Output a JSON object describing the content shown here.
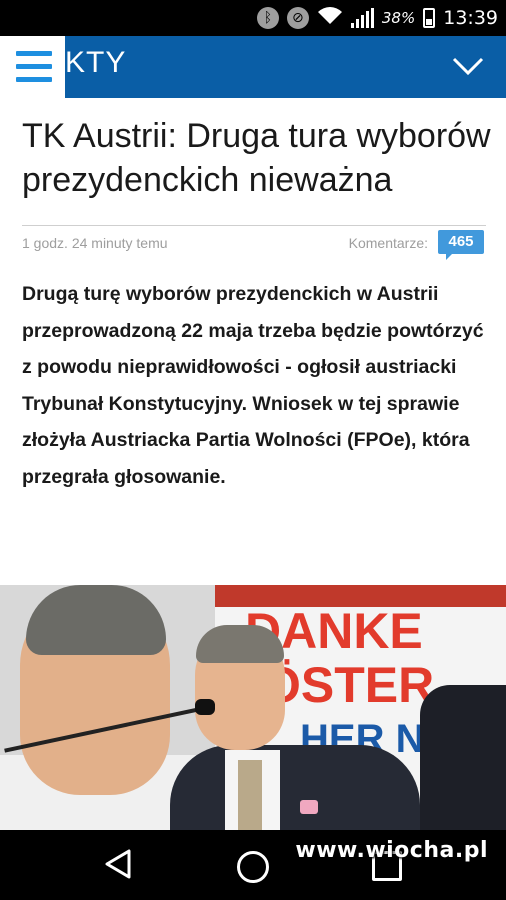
{
  "status_bar": {
    "icons": [
      "bluetooth-icon",
      "do-not-disturb-icon",
      "wifi-icon",
      "signal-icon",
      "battery-icon"
    ],
    "battery_percent": "38%",
    "time": "13:39"
  },
  "header": {
    "section_label": "KTY",
    "menu_icon": "hamburger-menu-icon",
    "expand_icon": "chevron-down-icon",
    "bg_color": "#0a5ea6",
    "accent_color": "#1e8fe0"
  },
  "article": {
    "title": "TK Austrii: Druga tura wyborów prezydenckich nieważna",
    "timestamp": "1 godz. 24 minuty temu",
    "comments_label": "Komentarze:",
    "comments_count": "465",
    "lead": "Drugą turę wyborów prezydenckich w Austrii przeprowadzoną 22 maja trzeba będzie powtórzyć z powodu nieprawidłowości - ogłosił austriacki Trybunał Konstytucyjny. Wniosek w tej sprawie złożyła Austriacka Partia Wolności (FPOe), która przegrała głosowanie.",
    "photo": {
      "banner_line1": "DANKE",
      "banner_line2": "ÖSTER",
      "banner_line3": "HER NO"
    }
  },
  "system_nav": {
    "buttons": [
      "back-icon",
      "home-icon",
      "recent-apps-icon"
    ]
  },
  "watermark": "www.wiocha.pl"
}
